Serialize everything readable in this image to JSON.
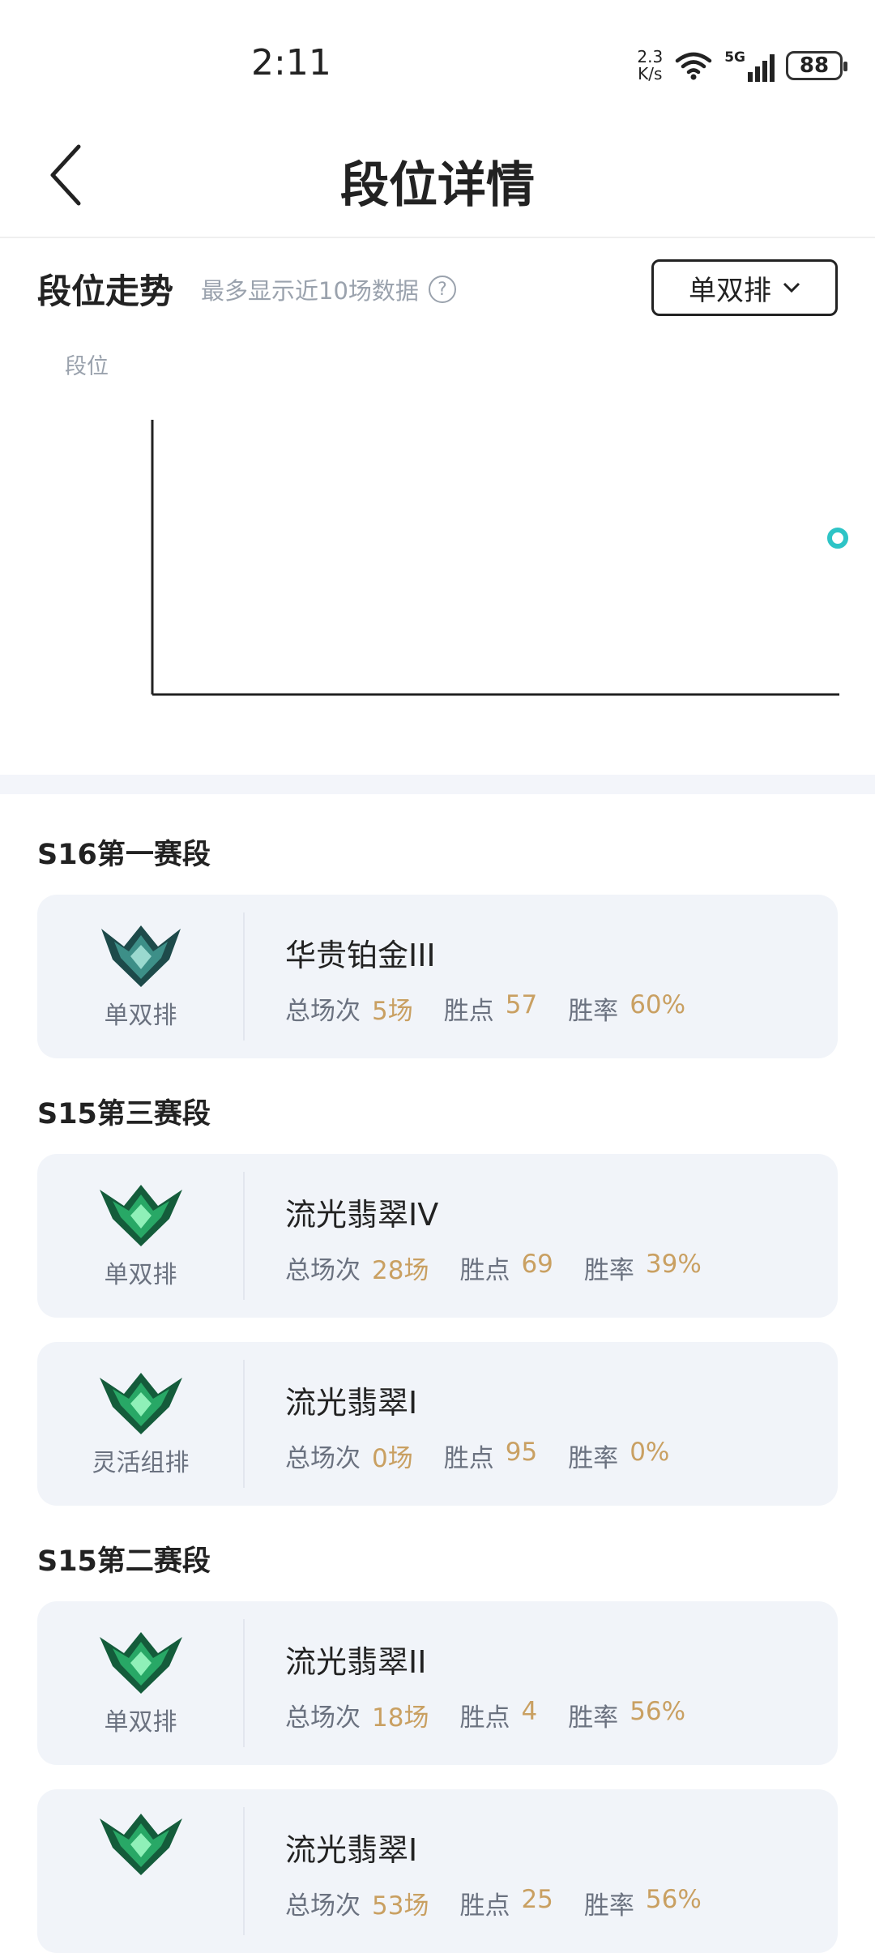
{
  "status_bar": {
    "time": "2:11",
    "net_speed_value": "2.3",
    "net_speed_unit": "K/s",
    "signal_label": "5G",
    "battery": "88"
  },
  "header": {
    "title": "段位详情"
  },
  "trend": {
    "title": "段位走势",
    "hint": "最多显示近10场数据",
    "queue_select": "单双排",
    "y_label": "段位",
    "point_color": "#2ec4c6"
  },
  "colors": {
    "accent_value": "#c9a062",
    "card_bg": "#f1f4f9",
    "emerald": "#1f8a5a"
  },
  "seasons": [
    {
      "title": "S16第一赛段",
      "cards": [
        {
          "queue": "单双排",
          "tier": "华贵铂金III",
          "emblem": "platinum-emblem-icon",
          "games_label": "总场次",
          "games": "5场",
          "lp_label": "胜点",
          "lp": "57",
          "wr_label": "胜率",
          "wr": "60%"
        }
      ]
    },
    {
      "title": "S15第三赛段",
      "cards": [
        {
          "queue": "单双排",
          "tier": "流光翡翠IV",
          "emblem": "emerald-emblem-icon",
          "games_label": "总场次",
          "games": "28场",
          "lp_label": "胜点",
          "lp": "69",
          "wr_label": "胜率",
          "wr": "39%"
        },
        {
          "queue": "灵活组排",
          "tier": "流光翡翠I",
          "emblem": "emerald-emblem-icon",
          "games_label": "总场次",
          "games": "0场",
          "lp_label": "胜点",
          "lp": "95",
          "wr_label": "胜率",
          "wr": "0%"
        }
      ]
    },
    {
      "title": "S15第二赛段",
      "cards": [
        {
          "queue": "单双排",
          "tier": "流光翡翠II",
          "emblem": "emerald-emblem-icon",
          "games_label": "总场次",
          "games": "18场",
          "lp_label": "胜点",
          "lp": "4",
          "wr_label": "胜率",
          "wr": "56%"
        },
        {
          "queue": "",
          "tier": "流光翡翠I",
          "emblem": "emerald-emblem-icon",
          "games_label": "总场次",
          "games": "53场",
          "lp_label": "胜点",
          "lp": "25",
          "wr_label": "胜率",
          "wr": "56%"
        }
      ]
    }
  ]
}
